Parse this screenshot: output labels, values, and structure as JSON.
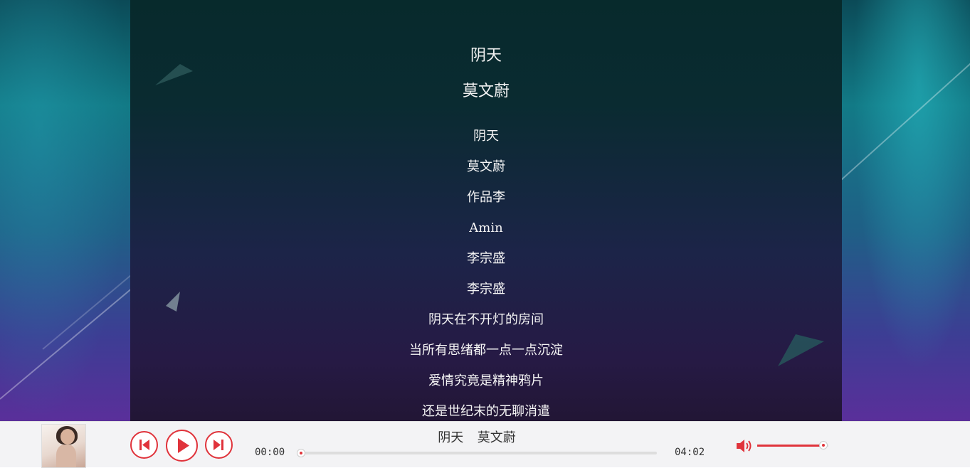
{
  "lyrics_view": {
    "title": "阴天",
    "artist": "莫文蔚",
    "lines": [
      "阴天",
      "莫文蔚",
      "作品李",
      "Amin",
      "李宗盛",
      "李宗盛",
      "阴天在不开灯的房间",
      "当所有思绪都一点一点沉淀",
      "爱情究竟是精神鸦片",
      "还是世纪末的无聊消遣"
    ]
  },
  "player": {
    "now_playing_title": "阴天",
    "now_playing_artist": "莫文蔚",
    "current_time": "00:00",
    "total_time": "04:02",
    "progress_fraction": 0.0,
    "volume_fraction": 0.93,
    "accent_color": "#e0333b",
    "controls": [
      "skip-previous-icon",
      "play-icon",
      "skip-next-icon",
      "volume-icon"
    ]
  }
}
